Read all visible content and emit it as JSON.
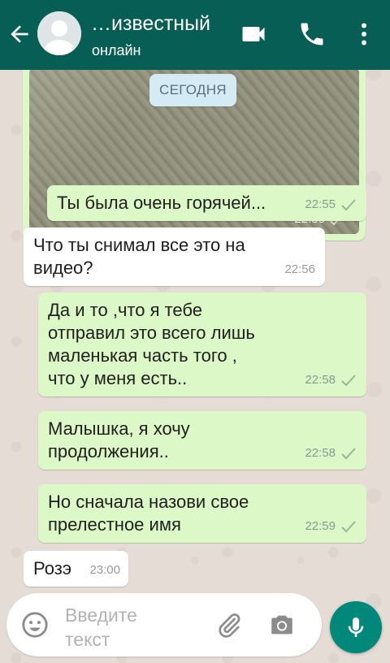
{
  "header": {
    "contact_name": "…известный",
    "status": "онлайн",
    "icons": {
      "back": "arrow-back-icon",
      "avatar": "default-avatar-icon",
      "video": "video-call-icon",
      "call": "phone-icon",
      "menu": "more-vertical-icon"
    },
    "color": "#075e54"
  },
  "chat": {
    "date_divider": "СЕГОДНЯ",
    "media_time": "22:55",
    "messages": [
      {
        "direction": "out",
        "text": "Ты была очень горячей...",
        "time": "22:55",
        "status": "sent"
      },
      {
        "direction": "in",
        "text": "Что ты снимал все это на видео?",
        "time": "22:56"
      },
      {
        "direction": "out",
        "text": "Да и то ,что я тебе отправил это всего лишь маленькая часть того , что у меня есть..",
        "time": "22:58",
        "status": "sent"
      },
      {
        "direction": "out",
        "text": "Малышка, я хочу продолжения..",
        "time": "22:58",
        "status": "sent"
      },
      {
        "direction": "out",
        "text": "Но сначала назови свое прелестное имя",
        "time": "22:59",
        "status": "sent"
      },
      {
        "direction": "in",
        "text": "Розэ",
        "time": "23:00"
      }
    ]
  },
  "composer": {
    "placeholder": "Введите текст",
    "icons": {
      "emoji": "emoji-icon",
      "attach": "paperclip-icon",
      "camera": "camera-icon",
      "mic": "microphone-icon"
    },
    "mic_color": "#00897b"
  },
  "colors": {
    "outgoing_bubble": "#dcf8c6",
    "incoming_bubble": "#ffffff",
    "wallpaper": "#e5ddd5"
  }
}
